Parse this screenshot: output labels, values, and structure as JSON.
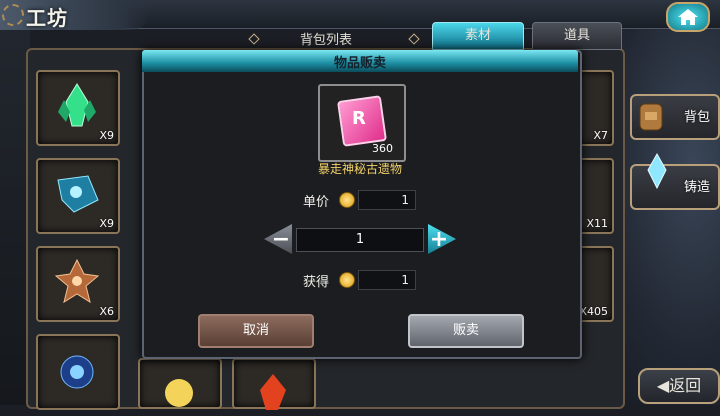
{
  "header": {
    "title": "工坊"
  },
  "inventory": {
    "list_label": "背包列表",
    "tabs": [
      {
        "label": "素材",
        "active": true
      },
      {
        "label": "道具",
        "active": false
      }
    ],
    "left_column": [
      {
        "icon": "green-crystal-icon",
        "count": "X9"
      },
      {
        "icon": "blue-gem-icon",
        "count": "X9"
      },
      {
        "icon": "orange-crystal-icon",
        "count": "X6"
      },
      {
        "icon": "blue-orb-icon",
        "count": ""
      }
    ],
    "right_column": [
      {
        "icon": "red-crystal-icon",
        "count": "X7"
      },
      {
        "icon": "gold-item-icon",
        "count": "X11"
      },
      {
        "icon": "material-icon",
        "count": "X405"
      }
    ]
  },
  "side_buttons": [
    {
      "label": "背包",
      "icon": "backpack-icon"
    },
    {
      "label": "铸造",
      "icon": "forge-crystal-icon"
    }
  ],
  "dialog": {
    "title": "物品贩卖",
    "item": {
      "name": "暴走神秘古遗物",
      "count": "360",
      "icon_letter": "R"
    },
    "unit_price_label": "单价",
    "unit_price": "1",
    "quantity": "1",
    "earn_label": "获得",
    "earn_value": "1",
    "cancel_label": "取消",
    "sell_label": "贩卖"
  },
  "footer": {
    "back_label": "返回"
  },
  "colors": {
    "accent": "#1d8ea3",
    "frame": "#8a7558"
  }
}
